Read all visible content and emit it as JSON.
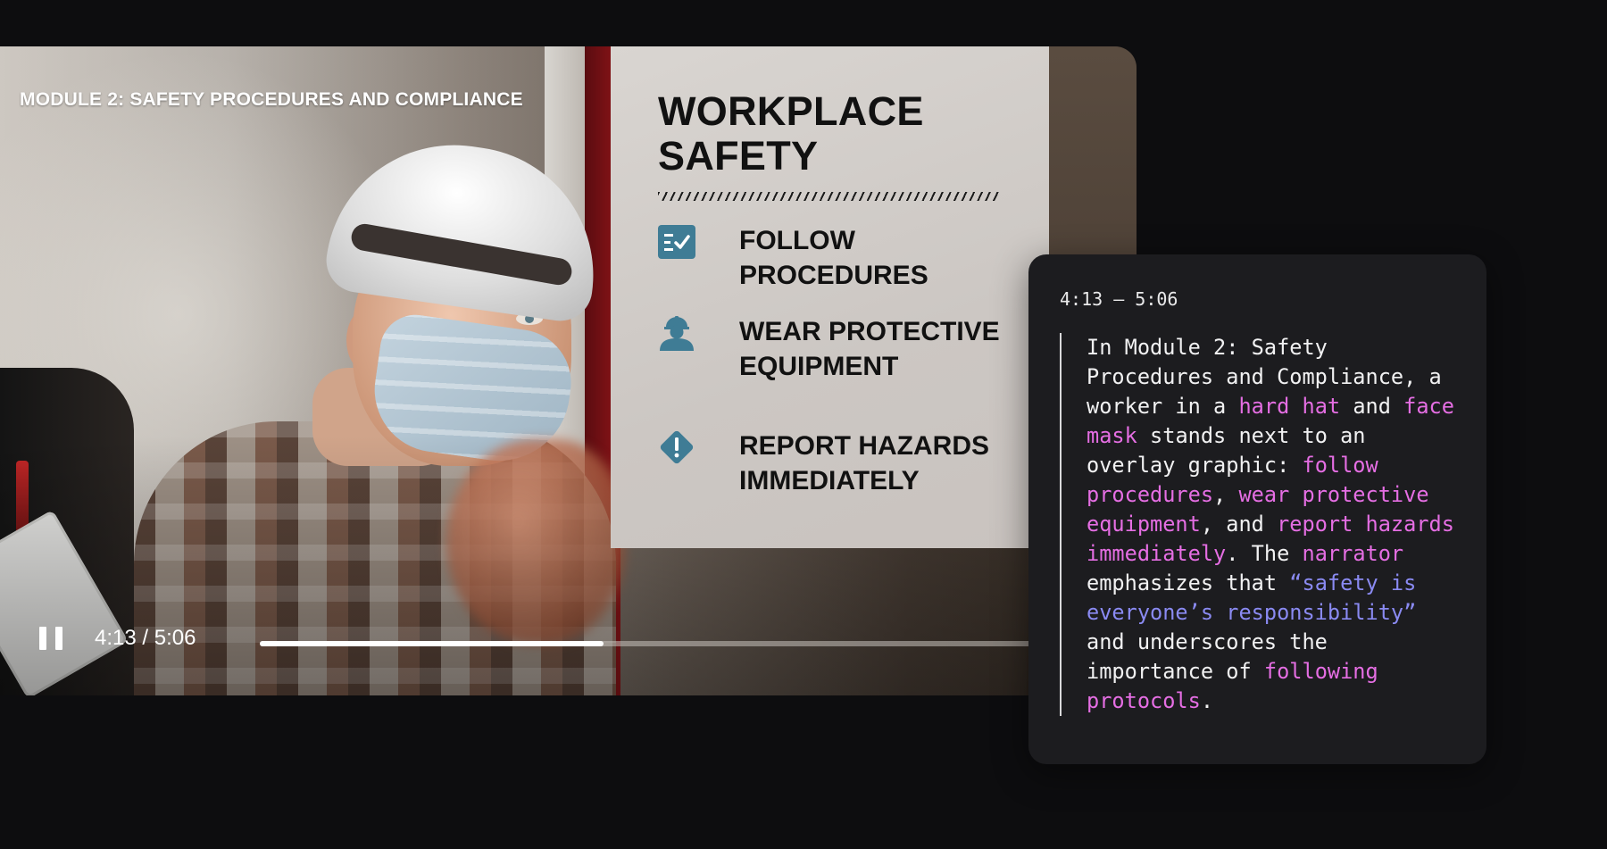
{
  "video": {
    "module_label": "MODULE 2: SAFETY PROCEDURES AND COMPLIANCE",
    "overlay": {
      "title": "WORKPLACE SAFETY",
      "items": [
        {
          "icon": "checklist-icon",
          "label": "FOLLOW PROCEDURES"
        },
        {
          "icon": "hardhat-worker-icon",
          "label": "WEAR PROTECTIVE EQUIPMENT"
        },
        {
          "icon": "warning-diamond-icon",
          "label": "REPORT HAZARDS IMMEDIATELY"
        }
      ],
      "icon_color": "#3f7c95"
    }
  },
  "controls": {
    "pause_icon": "pause-icon",
    "time": "4:13 / 5:06",
    "progress": 0.428
  },
  "transcript": {
    "time_range": "4:13 – 5:06",
    "segments": [
      {
        "text": "In Module 2: Safety Procedures and Compliance, a worker in a ",
        "style": "plain"
      },
      {
        "text": "hard hat",
        "style": "pink"
      },
      {
        "text": " and ",
        "style": "plain"
      },
      {
        "text": "face mask",
        "style": "pink"
      },
      {
        "text": " stands next to an overlay graphic: ",
        "style": "plain"
      },
      {
        "text": "follow procedures",
        "style": "pink"
      },
      {
        "text": ", ",
        "style": "plain"
      },
      {
        "text": "wear protective equipment",
        "style": "pink"
      },
      {
        "text": ", and ",
        "style": "plain"
      },
      {
        "text": "report hazards immediately",
        "style": "pink"
      },
      {
        "text": ". The ",
        "style": "plain"
      },
      {
        "text": "narrator",
        "style": "pink"
      },
      {
        "text": " emphasizes that ",
        "style": "plain"
      },
      {
        "text": "“safety is everyone’s responsibility”",
        "style": "blue"
      },
      {
        "text": " and underscores the importance of ",
        "style": "plain"
      },
      {
        "text": "following protocols",
        "style": "pink"
      },
      {
        "text": ".",
        "style": "plain"
      }
    ],
    "colors": {
      "pink": "#e56ee3",
      "blue": "#8a8af2"
    }
  }
}
